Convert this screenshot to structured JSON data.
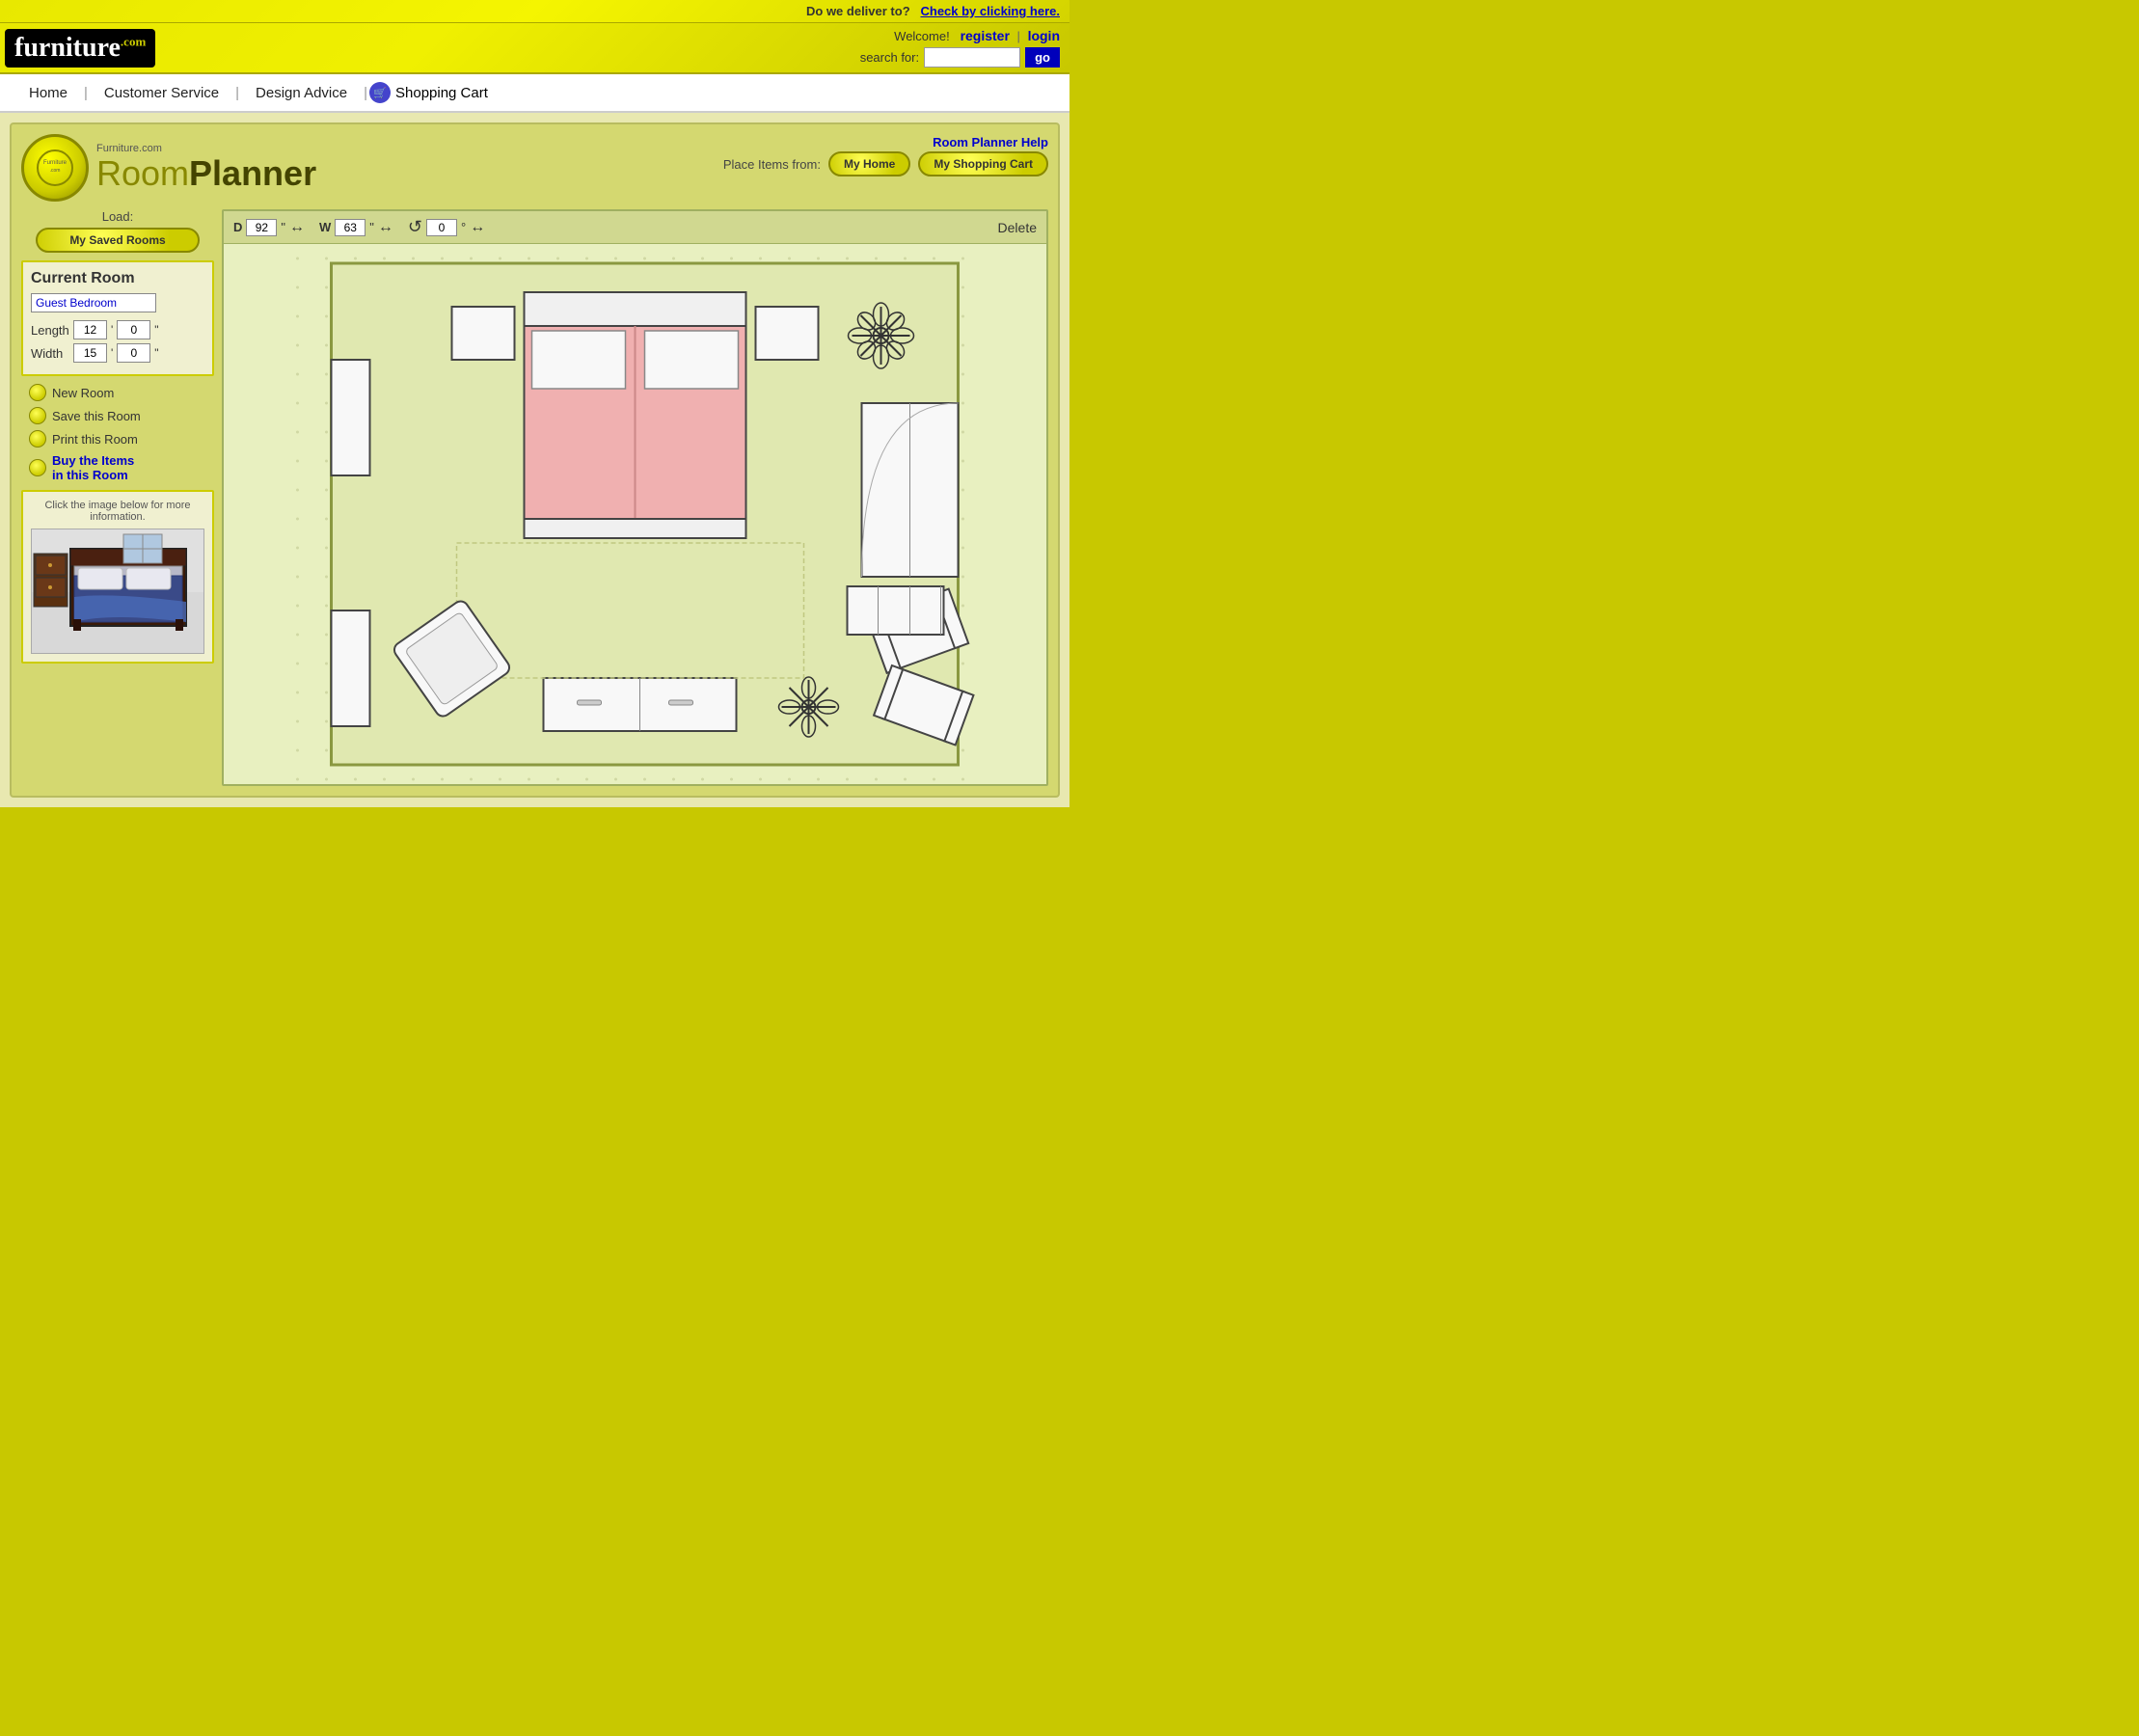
{
  "delivery": {
    "question": "Do we deliver to?",
    "link": "Check by clicking here."
  },
  "header": {
    "logo_furniture": "furniture",
    "logo_com": ".com",
    "welcome": "Welcome!",
    "register": "register",
    "separator": "|",
    "login": "login",
    "search_label": "search for:",
    "search_placeholder": "",
    "go_btn": "go"
  },
  "nav": {
    "home": "Home",
    "customer_service": "Customer Service",
    "design_advice": "Design Advice",
    "shopping_cart": "Shopping Cart"
  },
  "planner": {
    "help_link": "Room Planner Help",
    "logo_subtitle": "Furniture.com",
    "logo_room": "Room",
    "logo_planner": "Planner",
    "place_items_label": "Place Items from:",
    "my_home_btn": "My Home",
    "my_cart_btn": "My Shopping Cart",
    "load_label": "Load:",
    "saved_rooms_btn": "My Saved Rooms",
    "current_room_title": "Current Room",
    "room_name": "Guest Bedroom",
    "length_label": "Length",
    "length_ft": "12",
    "length_in": "0",
    "width_label": "Width",
    "width_ft": "15",
    "width_in": "0",
    "new_room": "New Room",
    "save_room": "Save this Room",
    "print_room": "Print this Room",
    "buy_items": "Buy the Items\nin this Room",
    "preview_caption": "Click the image below for more information.",
    "dim_d_label": "D",
    "dim_d_val": "92",
    "dim_d_unit": "\"",
    "dim_w_label": "W",
    "dim_w_val": "63",
    "dim_w_unit": "\"",
    "dim_rot_val": "0",
    "dim_rot_unit": "°",
    "delete_btn": "Delete"
  }
}
